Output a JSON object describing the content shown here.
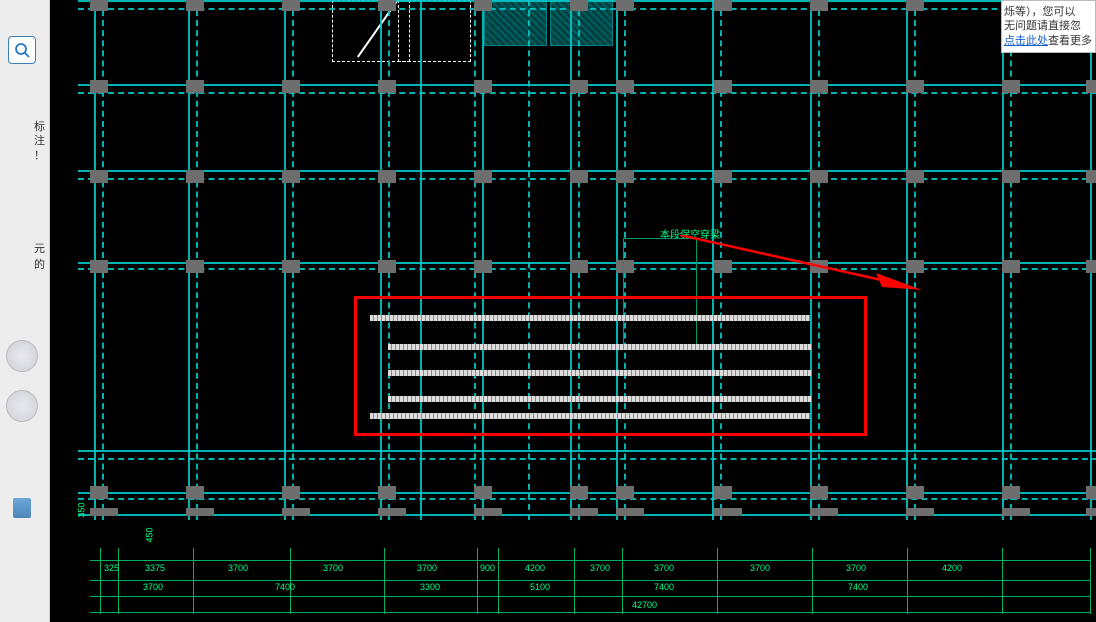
{
  "sidebar": {
    "search_aria": "search",
    "text1_l1": "标",
    "text1_l2": "注",
    "text1_l3": "！",
    "text2_l1": "元",
    "text2_l2": "的"
  },
  "tip": {
    "line1": "烁等），您可以",
    "line2": "无问题请直接忽",
    "link_text": "点击此处",
    "link_tail": "查看更多"
  },
  "annotation": {
    "label": "本段保空穿梁"
  },
  "dimensions": {
    "row1": [
      "325",
      "3375",
      "3700",
      "3700",
      "3700",
      "900",
      "4200",
      "3700",
      "3700",
      "3700",
      "3700",
      "4200"
    ],
    "row2": [
      "3700",
      "7400",
      "3300",
      "5100",
      "7400",
      "7400"
    ],
    "row3_center": "42700",
    "left_vert1": "350",
    "left_vert2": "450"
  },
  "colors": {
    "grid": "#00c8c8",
    "green": "#00b060",
    "highlight": "#ff0000",
    "column": "#6e6e6e"
  }
}
